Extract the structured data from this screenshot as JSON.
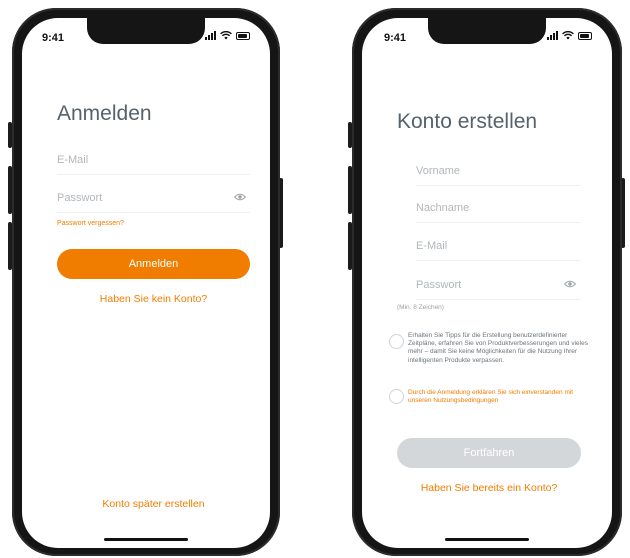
{
  "status": {
    "time": "9:41"
  },
  "login": {
    "title": "Anmelden",
    "email_placeholder": "E-Mail",
    "password_placeholder": "Passwort",
    "forgot_password": "Passwort vergessen?",
    "login_button": "Anmelden",
    "no_account": "Haben Sie kein Konto?",
    "create_later": "Konto später erstellen"
  },
  "signup": {
    "title": "Konto erstellen",
    "first_name_placeholder": "Vorname",
    "last_name_placeholder": "Nachname",
    "email_placeholder": "E-Mail",
    "password_placeholder": "Passwort",
    "password_hint": "(Min. 8 Zeichen)",
    "tips_checkbox_text": "Erhalten Sie Tipps für die Erstellung benutzerdefinierter Zeitpläne, erfahren Sie von Produktverbesserungen und vieles mehr – damit Sie keine Möglichkeiten für die Nutzung Ihrer intelligenten Produkte verpassen.",
    "terms_checkbox_text": "Durch die Anmeldung erklären Sie sich einverstanden mit unseren Nutzungsbedingungen",
    "continue_button": "Fortfahren",
    "has_account": "Haben Sie bereits ein Konto?"
  },
  "colors": {
    "accent": "#f07d00",
    "disabled_button": "#d4d7da",
    "title": "#56626c",
    "placeholder": "#b1b7bb"
  },
  "icons": [
    "signal-icon",
    "wifi-icon",
    "battery-icon",
    "eye-icon",
    "radio-unchecked-icon"
  ]
}
